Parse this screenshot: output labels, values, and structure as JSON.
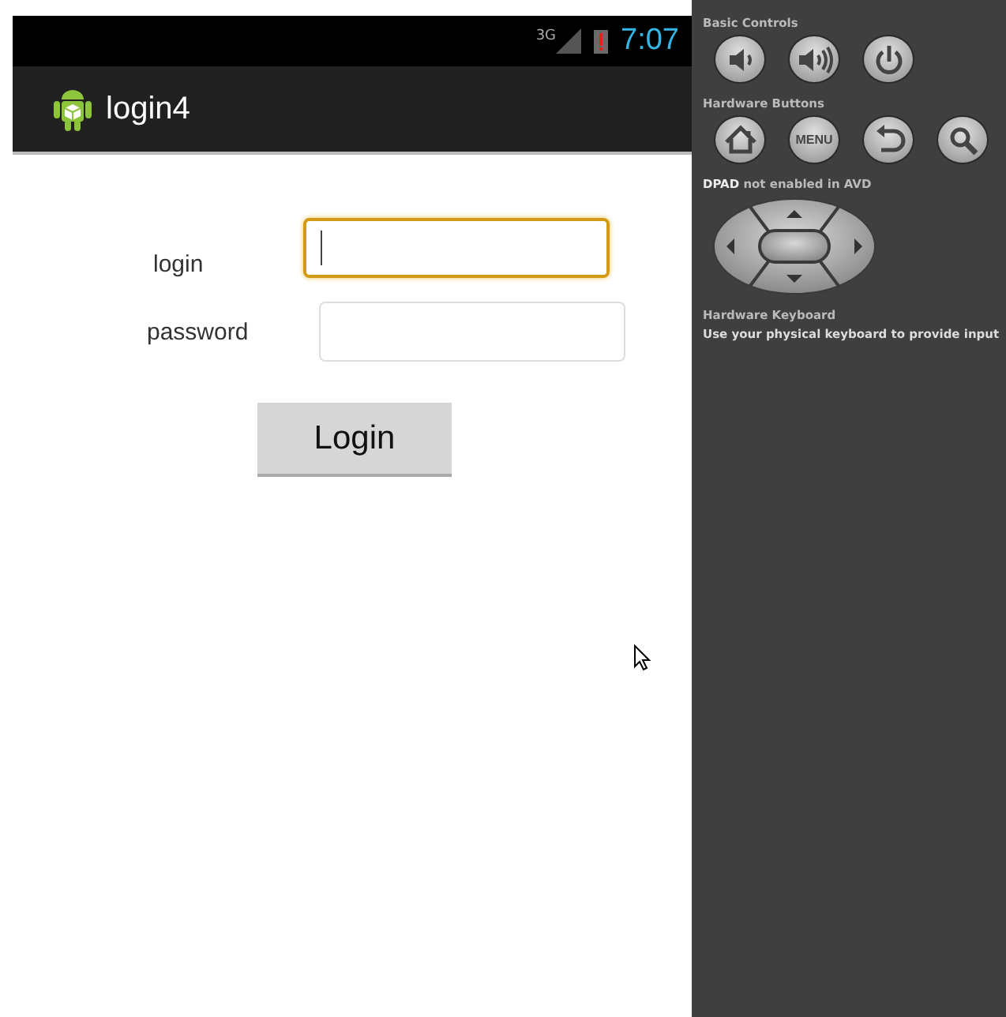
{
  "status_bar": {
    "network": "3G",
    "time": "7:07"
  },
  "action_bar": {
    "title": "login4"
  },
  "form": {
    "fields": [
      {
        "label": "login",
        "focused": true
      },
      {
        "label": "password",
        "focused": false
      }
    ],
    "button": "Login"
  },
  "controls_panel": {
    "sections": [
      {
        "kind": "buttons",
        "title": "Basic Controls",
        "buttons": [
          {
            "kind": "volume-down"
          },
          {
            "kind": "volume-up"
          },
          {
            "kind": "power"
          }
        ]
      },
      {
        "kind": "buttons",
        "title": "Hardware Buttons",
        "buttons": [
          {
            "kind": "home"
          },
          {
            "kind": "menu",
            "label": "MENU"
          },
          {
            "kind": "back"
          },
          {
            "kind": "search"
          }
        ]
      },
      {
        "kind": "dpad",
        "title": "**DPAD** not enabled in AVD"
      },
      {
        "kind": "note",
        "title": "Hardware Keyboard",
        "text": "Use your physical keyboard to provide input"
      }
    ]
  }
}
